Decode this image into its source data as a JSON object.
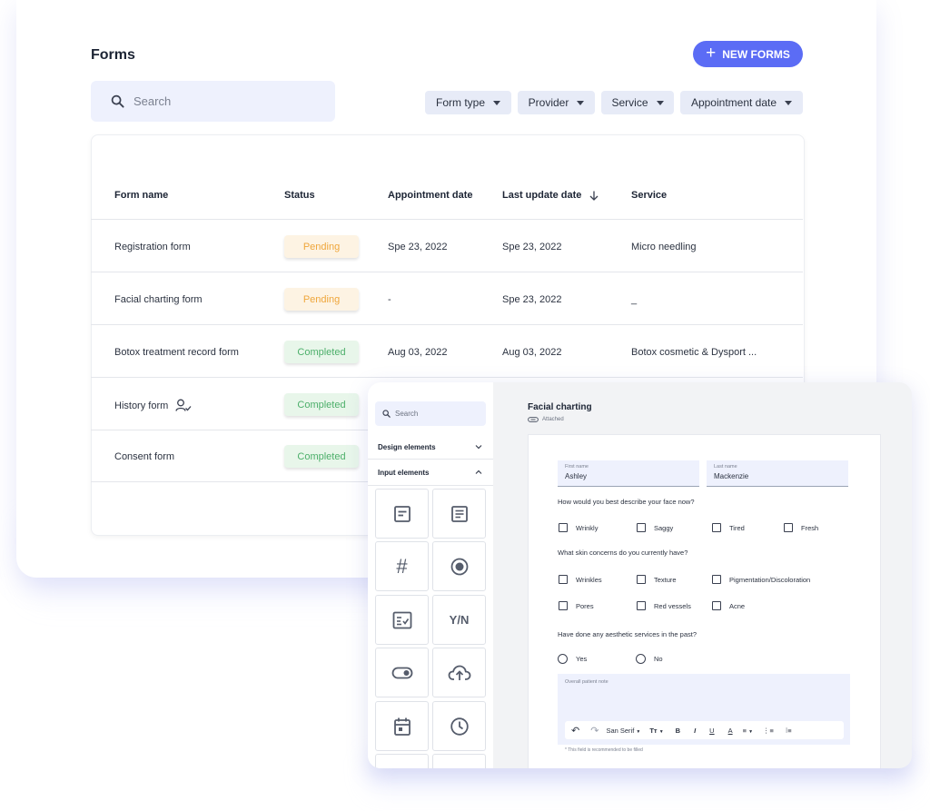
{
  "page": {
    "title": "Forms",
    "new_button": "NEW FORMS",
    "search_placeholder": "Search"
  },
  "filters": [
    "Form type",
    "Provider",
    "Service",
    "Appointment date"
  ],
  "table": {
    "columns": [
      "Form name",
      "Status",
      "Appointment date",
      "Last update date",
      "Service"
    ],
    "rows": [
      {
        "name": "Registration form",
        "status": "Pending",
        "appointment": "Spe 23, 2022",
        "updated": "Spe 23, 2022",
        "service": "Micro needling"
      },
      {
        "name": "Facial charting form",
        "status": "Pending",
        "appointment": "-",
        "updated": "Spe 23, 2022",
        "service": "_"
      },
      {
        "name": "Botox treatment record form",
        "status": "Completed",
        "appointment": "Aug 03, 2022",
        "updated": "Aug 03, 2022",
        "service": "Botox cosmetic & Dysport ..."
      },
      {
        "name": "History form",
        "status": "Completed"
      },
      {
        "name": "Consent form",
        "status": "Completed"
      }
    ]
  },
  "colors": {
    "accent": "#5b6cf5",
    "pending_text": "#efa63b",
    "pending_bg": "#fdf3e3",
    "completed_text": "#4caf6a",
    "completed_bg": "#e8f6ea"
  },
  "builder": {
    "sidebar": {
      "search_placeholder": "Search",
      "design_elements": "Design elements",
      "input_elements": "Input elements",
      "tiles": [
        "short-text-icon",
        "long-text-icon",
        "number-icon",
        "radio-icon",
        "checklist-icon",
        "yes-no-icon",
        "toggle-icon",
        "upload-icon",
        "calendar-icon",
        "clock-icon"
      ],
      "yes_no_label": "Y/N",
      "hash_label": "#"
    },
    "form": {
      "title": "Facial charting",
      "attached": "Attached",
      "first_name_label": "First name",
      "first_name": "Ashley",
      "last_name_label": "Last name",
      "last_name": "Mackenzie",
      "q1": "How would you best describe your face now?",
      "q1_options": [
        "Wrinkly",
        "Saggy",
        "Tired",
        "Fresh"
      ],
      "q2": "What skin concerns do you currently have?",
      "q2_options_row1": [
        "Wrinkles",
        "Texture",
        "Pigmentation/Discoloration"
      ],
      "q2_options_row2": [
        "Pores",
        "Red vessels",
        "Acne"
      ],
      "q3": "Have done any aesthetic services in the past?",
      "q3_options": [
        "Yes",
        "No"
      ],
      "note_label": "Overall patient note",
      "font_name": "San Serif",
      "hint": "* This field is recommended to be filled"
    }
  }
}
